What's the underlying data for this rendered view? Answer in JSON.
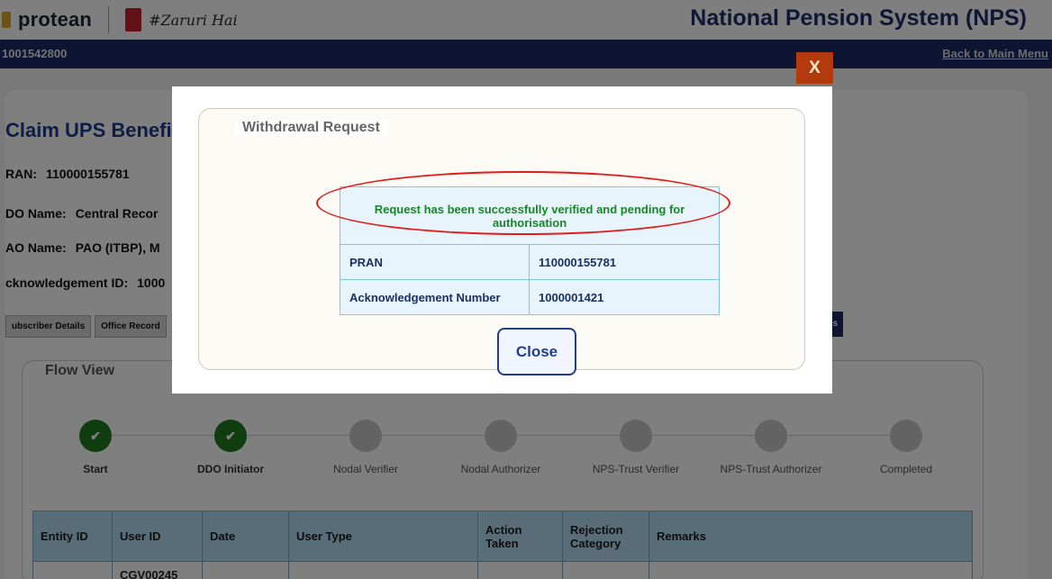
{
  "header": {
    "brand_name": "protean",
    "tagline": "#Zaruri Hai",
    "system_title": "National Pension System (NPS)",
    "account_id": "1001542800",
    "back_link": "Back to Main Menu"
  },
  "claim": {
    "title": "Claim UPS Benefi",
    "pran_label": "RAN:",
    "pran_value": "110000155781",
    "ddo_label": "DO Name:",
    "ddo_value": "Central Recor",
    "pao_label": "AO Name:",
    "pao_value": "PAO (ITBP), M",
    "ack_label": "cknowledgement ID:",
    "ack_value": "1000"
  },
  "tabs": {
    "subscriber": "ubscriber Details",
    "office": "Office Record",
    "right_tab": "s"
  },
  "flow": {
    "legend": "Flow View",
    "steps": [
      {
        "label": "Start",
        "done": true
      },
      {
        "label": "DDO Initiator",
        "done": true
      },
      {
        "label": "Nodal Verifier",
        "done": false
      },
      {
        "label": "Nodal Authorizer",
        "done": false
      },
      {
        "label": "NPS-Trust Verifier",
        "done": false
      },
      {
        "label": "NPS-Trust Authorizer",
        "done": false
      },
      {
        "label": "Completed",
        "done": false
      }
    ],
    "checkmark": "✔"
  },
  "history_table": {
    "headers": [
      "Entity ID",
      "User ID",
      "Date",
      "User Type",
      "Action Taken",
      "Rejection Category",
      "Remarks"
    ],
    "first_row_user_id": "CGV00245"
  },
  "modal": {
    "close_x": "X",
    "legend": "Withdrawal Request",
    "message": "Request has been successfully verified and pending for authorisation",
    "rows": [
      {
        "label": "PRAN",
        "value": "110000155781"
      },
      {
        "label": "Acknowledgement Number",
        "value": "1000001421"
      }
    ],
    "close_button": "Close"
  },
  "colors": {
    "nav_blue": "#1b2a64",
    "success_green": "#17852a",
    "annotation_red": "#e21b1b",
    "close_x_bg": "#b33a0f"
  }
}
